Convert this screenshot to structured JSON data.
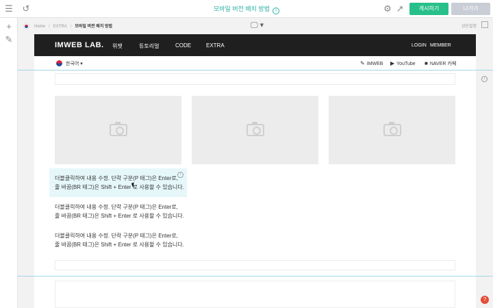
{
  "topbar": {
    "title": "모바일 버전 배치 방법",
    "info_glyph": "i",
    "publish_label": "게시하기",
    "exit_label": "나가기",
    "icons": [
      "menu-icon",
      "undo-icon",
      "gear-icon",
      "external-link-icon"
    ]
  },
  "lefttools": {
    "icons": [
      "plus-icon",
      "brush-icon"
    ]
  },
  "breadcrumb": {
    "items": [
      "Home",
      "EXTRA"
    ],
    "current": "모바일 버전 배치 방법",
    "fixed_label": "상단설정"
  },
  "site": {
    "logo": "IMWEB LAB.",
    "nav": [
      "위젯",
      "튜토리얼",
      "CODE",
      "EXTRA"
    ],
    "login": "LOGIN",
    "member": "MEMBER",
    "language": "한국어",
    "links": [
      {
        "label": "IMWEB",
        "icon": "edit-icon"
      },
      {
        "label": "YouTube",
        "icon": "youtube-icon"
      },
      {
        "label": "NAVER 카페",
        "icon": "naver-icon"
      }
    ]
  },
  "content": {
    "paragraphs": [
      {
        "line1": "더블클릭하여 내용 수정. 단락 구분(P 태그)은 Enter로,",
        "line2": "줄 바꿈(BR 태그)은 Shift + Enter 로 사용할 수 있습니다."
      },
      {
        "line1": "더블클릭하여 내용 수정. 단락 구분(P 태그)은 Enter로,",
        "line2": "줄 바꿈(BR 태그)은 Shift + Enter 로 사용할 수 있습니다."
      },
      {
        "line1": "더블클릭하여 내용 수정. 단락 구분(P 태그)은 Enter로,",
        "line2": "줄 바꿈(BR 태그)은 Shift + Enter 로 사용할 수 있습니다."
      }
    ]
  },
  "help_glyph": "?",
  "colors": {
    "accent": "#2bb0a3",
    "publish": "#28c08a",
    "exit": "#c9ced6",
    "header_bg": "#1f1f1f",
    "selection": "#e6f7fa",
    "guide": "#9fd6ea"
  }
}
